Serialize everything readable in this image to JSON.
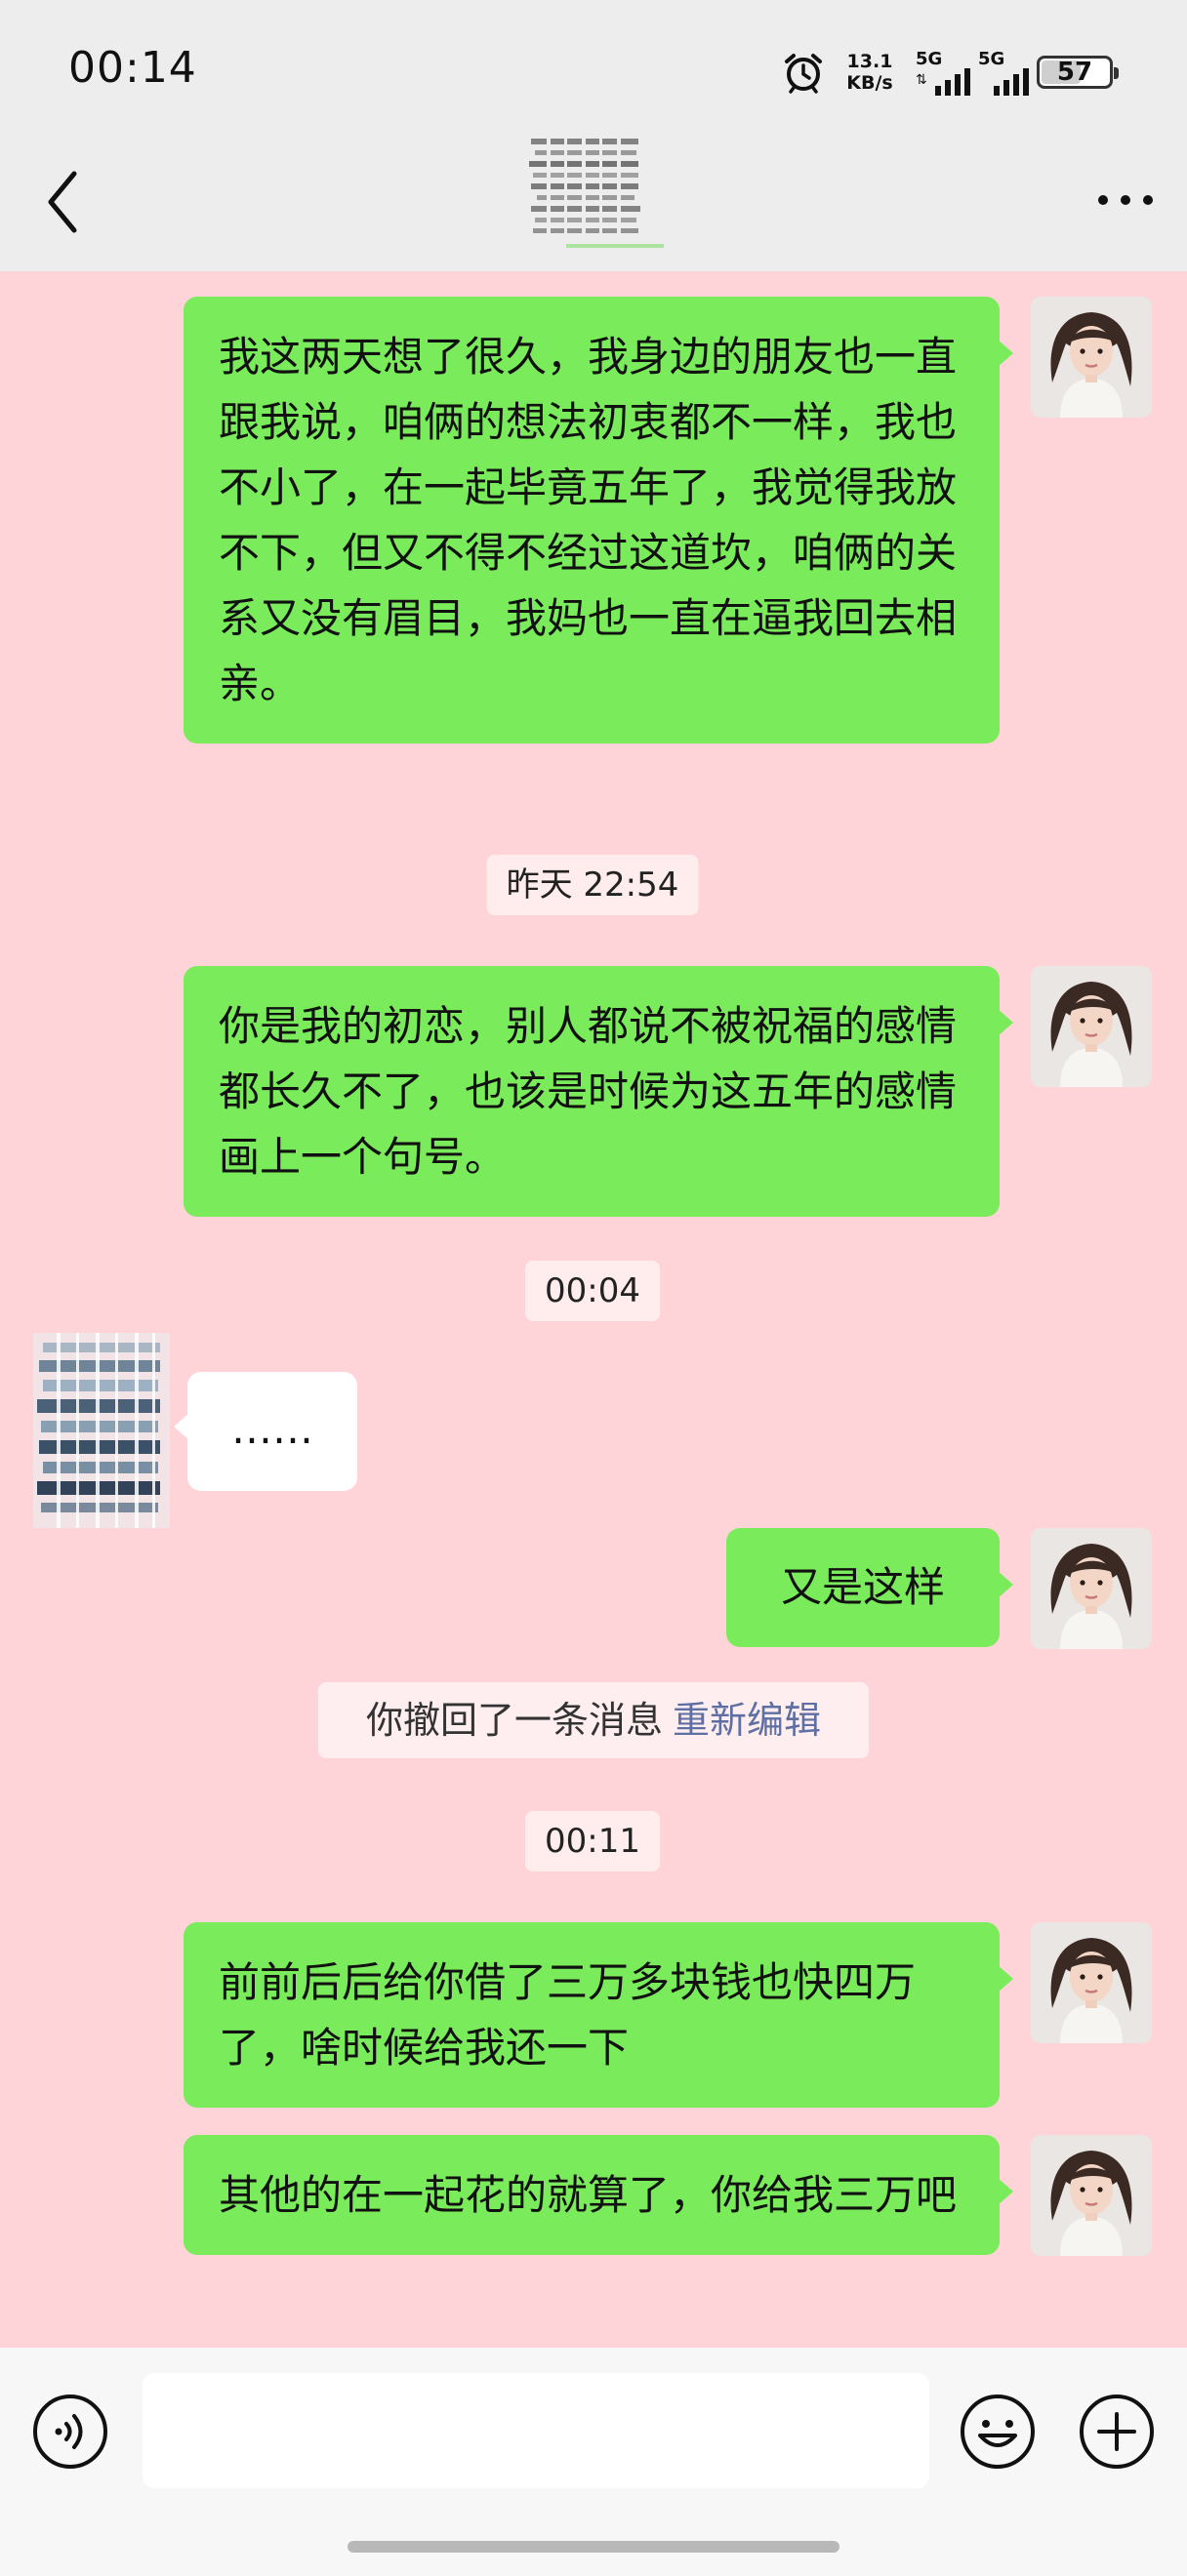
{
  "status_bar": {
    "time": "00:14",
    "net_speed_value": "13.1",
    "net_speed_unit": "KB/s",
    "network_1": "5G",
    "network_2": "5G",
    "battery_level": "57",
    "alarm_icon": "alarm-clock-icon"
  },
  "header": {
    "back_icon": "chevron-left-icon",
    "more_icon": "more-dots-icon"
  },
  "colors": {
    "chat_background": "#ffd4d8",
    "bubble_self": "#7aeb5a",
    "bubble_other": "#ffffff",
    "link": "#5d6fa3"
  },
  "messages": [
    {
      "side": "self",
      "text": "我这两天想了很久，我身边的朋友也一直跟我说，咱俩的想法初衷都不一样，我也不小了，在一起毕竟五年了，我觉得我放不下，但又不得不经过这道坎，咱俩的关系又没有眉目，我妈也一直在逼我回去相亲。"
    },
    {
      "type": "timestamp",
      "text": "昨天 22:54"
    },
    {
      "side": "self",
      "text": "你是我的初恋，别人都说不被祝福的感情都长久不了，也该是时候为这五年的感情画上一个句号。"
    },
    {
      "type": "timestamp",
      "text": "00:04"
    },
    {
      "side": "other",
      "text": "……"
    },
    {
      "side": "self",
      "text": "又是这样"
    },
    {
      "type": "recall",
      "text": "你撤回了一条消息",
      "action": "重新编辑"
    },
    {
      "type": "timestamp",
      "text": "00:11"
    },
    {
      "side": "self",
      "text": "前前后后给你借了三万多块钱也快四万了，啥时候给我还一下"
    },
    {
      "side": "self",
      "text": "其他的在一起花的就算了，你给我三万吧"
    }
  ],
  "input_bar": {
    "voice_icon": "voice-icon",
    "input_value": "",
    "emoji_icon": "emoji-icon",
    "plus_icon": "plus-icon"
  }
}
